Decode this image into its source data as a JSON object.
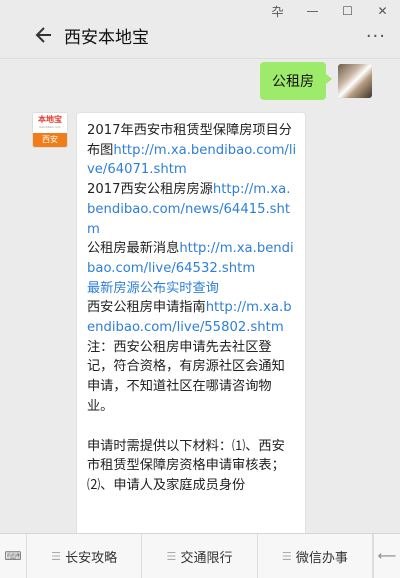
{
  "window": {
    "pin": "卆",
    "minimize": "—",
    "maximize": "☐",
    "close": "✕"
  },
  "header": {
    "title": "西安本地宝",
    "more": "···"
  },
  "chat": {
    "user_message": "公租房",
    "bot": {
      "logo_text": "本地宝",
      "logo_sub": "bendibao.com",
      "logo_city": "西安"
    },
    "reply": {
      "t1": "2017年西安市租赁型保障房项目分布图",
      "l1": "http://m.xa.bendibao.com/live/64071.shtm",
      "t2": "2017西安公租房房源",
      "l2": "http://m.xa.bendibao.com/news/64415.shtm",
      "t3": "公租房最新消息",
      "l3": "http://m.xa.bendibao.com/live/64532.shtm",
      "l4": "最新房源公布实时查询",
      "t5": "西安公租房申请指南",
      "l5": "http://m.xa.bendibao.com/live/55802.shtm",
      "note": "注：西安公租房申请先去社区登记，符合资格，有房源社区会通知申请，不知道社区在哪请咨询物业。",
      "materials": "申请时需提供以下材料：⑴、西安市租赁型保障房资格申请审核表；⑵、申请人及家庭成员身份"
    }
  },
  "bottom_bar": {
    "keyboard": "⌨",
    "tab1": "长安攻略",
    "tab2": "交通限行",
    "tab3": "微信办事",
    "arrow": "⟵"
  }
}
